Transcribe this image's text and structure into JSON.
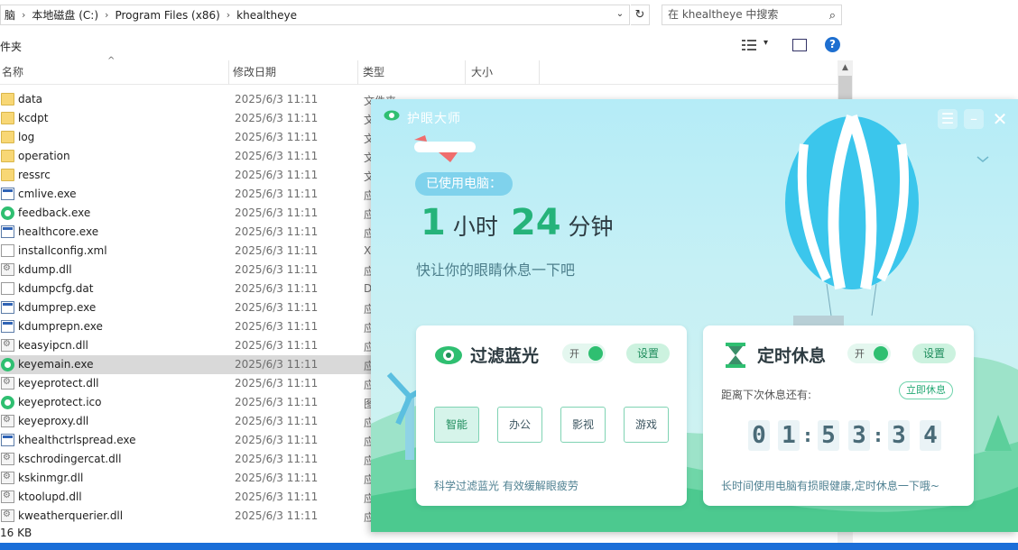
{
  "explorer": {
    "breadcrumbs": [
      "脑",
      "本地磁盘 (C:)",
      "Program Files (x86)",
      "khealtheye"
    ],
    "search_placeholder": "在 khealtheye 中搜索",
    "command_label": "件夹",
    "columns": [
      "名称",
      "修改日期",
      "类型",
      "大小"
    ],
    "files": [
      {
        "name": "data",
        "date": "2025/6/3 11:11",
        "type": "文件夹",
        "icon": "folder"
      },
      {
        "name": "kcdpt",
        "date": "2025/6/3 11:11",
        "type": "文",
        "icon": "folder"
      },
      {
        "name": "log",
        "date": "2025/6/3 11:11",
        "type": "文",
        "icon": "folder"
      },
      {
        "name": "operation",
        "date": "2025/6/3 11:11",
        "type": "文",
        "icon": "folder"
      },
      {
        "name": "ressrc",
        "date": "2025/6/3 11:11",
        "type": "文",
        "icon": "folder"
      },
      {
        "name": "cmlive.exe",
        "date": "2025/6/3 11:11",
        "type": "应",
        "icon": "exe"
      },
      {
        "name": "feedback.exe",
        "date": "2025/6/3 11:11",
        "type": "应",
        "icon": "eye"
      },
      {
        "name": "healthcore.exe",
        "date": "2025/6/3 11:11",
        "type": "应",
        "icon": "exe"
      },
      {
        "name": "installconfig.xml",
        "date": "2025/6/3 11:11",
        "type": "X",
        "icon": "doc"
      },
      {
        "name": "kdump.dll",
        "date": "2025/6/3 11:11",
        "type": "应",
        "icon": "dll"
      },
      {
        "name": "kdumpcfg.dat",
        "date": "2025/6/3 11:11",
        "type": "D",
        "icon": "doc"
      },
      {
        "name": "kdumprep.exe",
        "date": "2025/6/3 11:11",
        "type": "应",
        "icon": "exe"
      },
      {
        "name": "kdumprepn.exe",
        "date": "2025/6/3 11:11",
        "type": "应",
        "icon": "exe"
      },
      {
        "name": "keasyipcn.dll",
        "date": "2025/6/3 11:11",
        "type": "应",
        "icon": "dll"
      },
      {
        "name": "keyemain.exe",
        "date": "2025/6/3 11:11",
        "type": "应",
        "icon": "eye",
        "selected": true
      },
      {
        "name": "keyeprotect.dll",
        "date": "2025/6/3 11:11",
        "type": "应",
        "icon": "dll"
      },
      {
        "name": "keyeprotect.ico",
        "date": "2025/6/3 11:11",
        "type": "图",
        "icon": "eye"
      },
      {
        "name": "keyeproxy.dll",
        "date": "2025/6/3 11:11",
        "type": "应",
        "icon": "dll"
      },
      {
        "name": "khealthctrlspread.exe",
        "date": "2025/6/3 11:11",
        "type": "应",
        "icon": "exe"
      },
      {
        "name": "kschrodingercat.dll",
        "date": "2025/6/3 11:11",
        "type": "应",
        "icon": "dll"
      },
      {
        "name": "kskinmgr.dll",
        "date": "2025/6/3 11:11",
        "type": "应",
        "icon": "dll"
      },
      {
        "name": "ktoolupd.dll",
        "date": "2025/6/3 11:11",
        "type": "应",
        "icon": "dll"
      },
      {
        "name": "kweatherquerier.dll",
        "date": "2025/6/3 11:11",
        "type": "应",
        "icon": "dll"
      }
    ],
    "status_text": "16 KB"
  },
  "popup": {
    "title": "护眼大师",
    "used_label": "已使用电脑：",
    "hours": "1",
    "hours_unit": "小时",
    "minutes": "24",
    "minutes_unit": "分钟",
    "hint": "快让你的眼睛休息一下吧",
    "filter": {
      "title": "过滤蓝光",
      "toggle_label": "开",
      "settings_label": "设置",
      "modes": [
        "智能",
        "办公",
        "影视",
        "游戏"
      ],
      "active_mode": "智能",
      "footer": "科学过滤蓝光 有效缓解眼疲劳"
    },
    "break": {
      "title": "定时休息",
      "toggle_label": "开",
      "settings_label": "设置",
      "countdown_label": "距离下次休息还有:",
      "rest_now_label": "立即休息",
      "digits": [
        "0",
        "1",
        "5",
        "3",
        "3",
        "4"
      ],
      "footer": "长时间使用电脑有损眼健康,定时休息一下哦~"
    }
  },
  "colors": {
    "accent_green": "#2fbf71",
    "number_green": "#25b37a",
    "sky_top": "#b5ecf7",
    "balloon_blue": "#3bc6ec",
    "taskbar_blue": "#1a6ed8"
  }
}
